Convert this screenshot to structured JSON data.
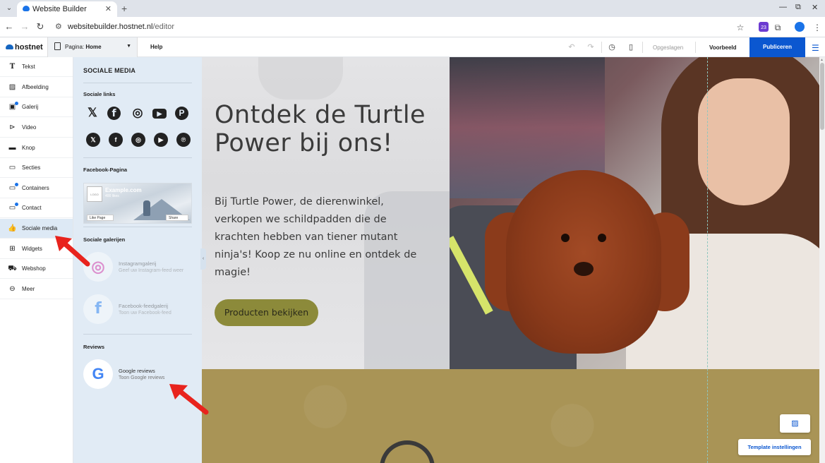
{
  "browser": {
    "tab_title": "Website Builder",
    "tab_close": "✕",
    "new_tab": "+",
    "url_host": "websitebuilder.hostnet.nl",
    "url_path": "/editor",
    "extension_badge": "23"
  },
  "toolbar": {
    "brand": "hostnet",
    "page_prefix": "Pagina:",
    "page_name": "Home",
    "help": "Help",
    "saved": "Opgeslagen",
    "preview": "Voorbeeld",
    "publish": "Publiceren"
  },
  "leftnav": {
    "items": [
      {
        "label": "Tekst",
        "icon": "T"
      },
      {
        "label": "Afbeelding",
        "icon": "▨"
      },
      {
        "label": "Galerij",
        "icon": "▣"
      },
      {
        "label": "Video",
        "icon": "▷"
      },
      {
        "label": "Knop",
        "icon": "▭"
      },
      {
        "label": "Secties",
        "icon": "▭"
      },
      {
        "label": "Containers",
        "icon": "▭"
      },
      {
        "label": "Contact",
        "icon": "▭"
      },
      {
        "label": "Sociale media",
        "icon": "👍"
      },
      {
        "label": "Widgets",
        "icon": "⊞"
      },
      {
        "label": "Webshop",
        "icon": "🛒"
      },
      {
        "label": "Meer",
        "icon": "⋯"
      }
    ]
  },
  "panel": {
    "title": "SOCIALE MEDIA",
    "links_heading": "Sociale links",
    "facebook_page_heading": "Facebook-Pagina",
    "galleries_heading": "Sociale galerijen",
    "reviews_heading": "Reviews",
    "social_icons_outline": [
      "𝕏",
      "f",
      "◎",
      "▶",
      "P"
    ],
    "social_icons_round": [
      "𝕏",
      "f",
      "◎",
      "▶",
      "℗"
    ],
    "fb_card": {
      "logo": "LOGO",
      "name": "Example.com",
      "likes": "400 likes",
      "like_btn": "Like Page",
      "share_btn": "Share"
    },
    "galleries": [
      {
        "title": "Instagramgalerij",
        "subtitle": "Geef uw Instagram-feed weer",
        "icon": "◎"
      },
      {
        "title": "Facebook-feedgalerij",
        "subtitle": "Toon uw Facebook-feed",
        "icon": "f"
      }
    ],
    "reviews": [
      {
        "title": "Google reviews",
        "subtitle": "Toon Google reviews",
        "icon": "G"
      }
    ]
  },
  "hero": {
    "title": "Ontdek de Turtle Power bij ons!",
    "text": "Bij Turtle Power, de dierenwinkel, verkopen we schildpadden die de krachten hebben van tiener mutant ninja's! Koop ze nu online en ontdek de magie!",
    "cta": "Producten bekijken"
  },
  "floating": {
    "template_settings": "Template instellingen"
  },
  "colors": {
    "accent": "#0b57d0",
    "panel_bg": "#e1ebf5",
    "cta_bg": "#8c8a3a",
    "section2_bg": "#a99456",
    "annotation_arrow": "#e8231d"
  }
}
